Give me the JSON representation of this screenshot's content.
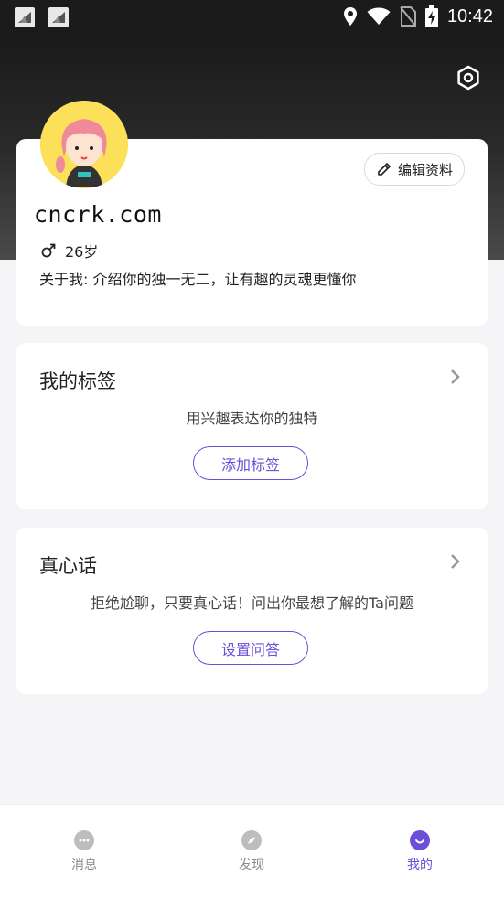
{
  "status_bar": {
    "time": "10:42",
    "icons": [
      "app-notification-icon",
      "app-notification-icon",
      "location-icon",
      "wifi-icon",
      "no-sim-icon",
      "battery-charging-icon"
    ]
  },
  "profile": {
    "username": "cncrk.com",
    "age": "26岁",
    "gender_icon": "male-icon",
    "about": "关于我: 介绍你的独一无二，让有趣的灵魂更懂你",
    "edit_label": "编辑资料"
  },
  "tags_section": {
    "title": "我的标签",
    "description": "用兴趣表达你的独特",
    "button_label": "添加标签"
  },
  "qa_section": {
    "title": "真心话",
    "description": "拒绝尬聊，只要真心话！问出你最想了解的Ta问题",
    "button_label": "设置问答"
  },
  "bottom_nav": {
    "items": [
      {
        "label": "消息",
        "icon": "chat-bubble-icon",
        "active": false
      },
      {
        "label": "发现",
        "icon": "compass-icon",
        "active": false
      },
      {
        "label": "我的",
        "icon": "smile-icon",
        "active": true
      }
    ]
  },
  "colors": {
    "accent": "#6b4fd8",
    "background": "#f5f5f7",
    "header_dark": "#1a1a1a"
  }
}
